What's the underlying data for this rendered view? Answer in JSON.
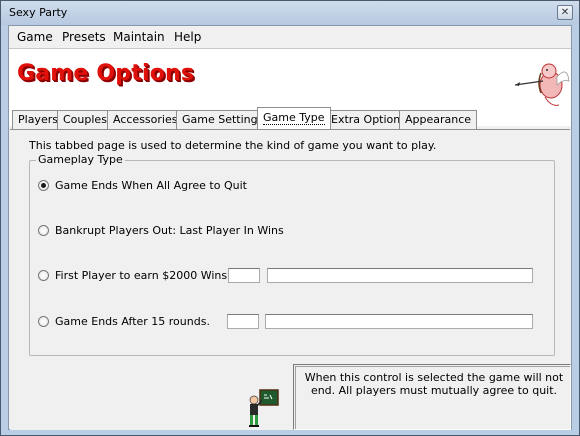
{
  "window": {
    "title": "Sexy Party",
    "close_glyph": "✕"
  },
  "menu": [
    "Game",
    "Presets",
    "Maintain",
    "Help"
  ],
  "banner": {
    "title": "Game Options",
    "logo_icon": "cupid-archer-icon"
  },
  "tabs": [
    {
      "label": "Players",
      "active": false
    },
    {
      "label": "Couples",
      "active": false
    },
    {
      "label": "Accessories",
      "active": false
    },
    {
      "label": "Game Settings",
      "active": false
    },
    {
      "label": "Game Type",
      "active": true
    },
    {
      "label": "Extra Options",
      "active": false
    },
    {
      "label": "Appearance",
      "active": false
    }
  ],
  "page": {
    "description": "This tabbed page is used to determine the kind of game you want to play.",
    "group_title": "Gameplay Type",
    "options": [
      {
        "label": "Game Ends When All Agree to Quit",
        "checked": true
      },
      {
        "label": "Bankrupt Players Out: Last Player In Wins",
        "checked": false
      },
      {
        "label": "First Player to earn $2000 Wins.",
        "checked": false
      },
      {
        "label": "Game Ends After 15 rounds.",
        "checked": false
      }
    ],
    "help_text": "When this control is selected the game will not end. All players must mutually agree to quit.",
    "help_icon": "teacher-chalkboard-icon"
  },
  "colors": {
    "banner_title": "#e0100a",
    "banner_shadow": "#8a0000"
  }
}
